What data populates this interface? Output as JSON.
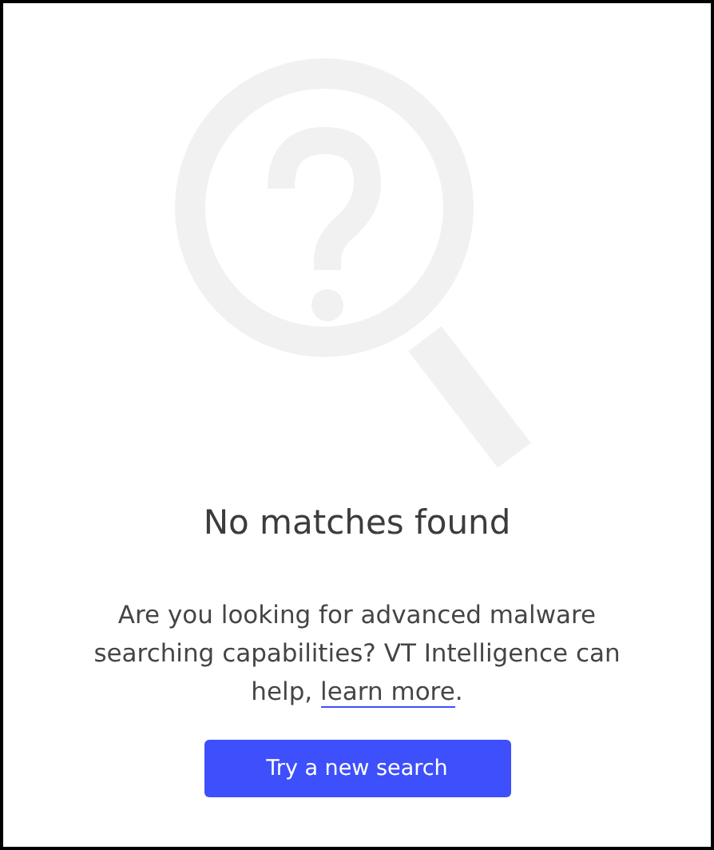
{
  "empty_state": {
    "title": "No matches found",
    "message": {
      "text": "Are you looking for advanced malware searching capabilities? VT Intelligence can help, ",
      "link": "learn more",
      "suffix": "."
    },
    "button": "Try a new search"
  }
}
